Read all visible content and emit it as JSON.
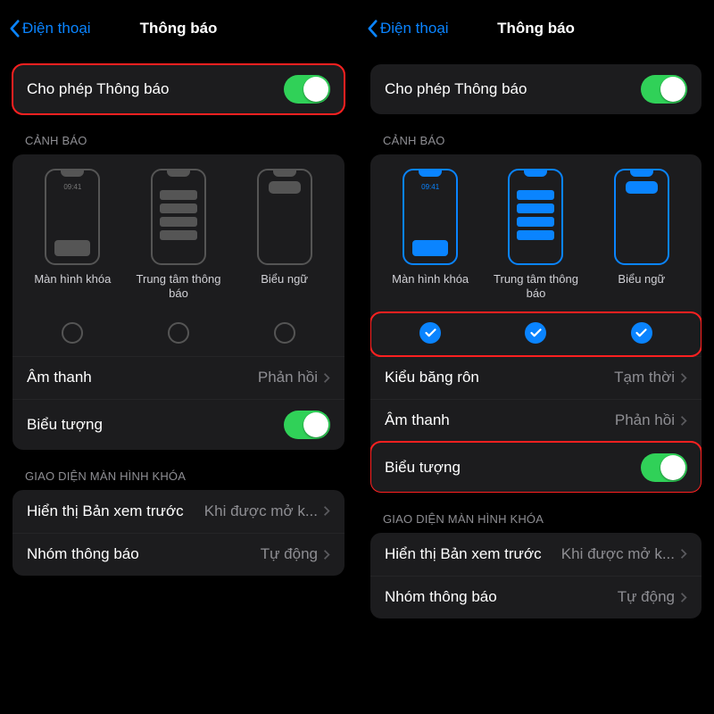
{
  "left": {
    "back_label": "Điện thoại",
    "title": "Thông báo",
    "allow": {
      "label": "Cho phép Thông báo",
      "on": true,
      "highlight": true
    },
    "alerts_header": "CẢNH BÁO",
    "alerts": [
      {
        "key": "lock",
        "label": "Màn hình khóa",
        "time": "09:41",
        "checked": false
      },
      {
        "key": "center",
        "label": "Trung tâm thông báo",
        "checked": false
      },
      {
        "key": "banner",
        "label": "Biểu ngữ",
        "checked": false
      }
    ],
    "check_highlight": false,
    "alerts_active": false,
    "banner_style_row": null,
    "sound": {
      "label": "Âm thanh",
      "value": "Phản hồi"
    },
    "badge": {
      "label": "Biểu tượng",
      "on": true,
      "highlight": false
    },
    "lockscreen_header": "GIAO DIỆN MÀN HÌNH KHÓA",
    "preview": {
      "label": "Hiển thị Bản xem trước",
      "value": "Khi được mở k..."
    },
    "grouping": {
      "label": "Nhóm thông báo",
      "value": "Tự động"
    }
  },
  "right": {
    "back_label": "Điện thoại",
    "title": "Thông báo",
    "allow": {
      "label": "Cho phép Thông báo",
      "on": true,
      "highlight": false
    },
    "alerts_header": "CẢNH BÁO",
    "alerts": [
      {
        "key": "lock",
        "label": "Màn hình khóa",
        "time": "09:41",
        "checked": true
      },
      {
        "key": "center",
        "label": "Trung tâm thông báo",
        "checked": true
      },
      {
        "key": "banner",
        "label": "Biểu ngữ",
        "checked": true
      }
    ],
    "check_highlight": true,
    "alerts_active": true,
    "banner_style_row": {
      "label": "Kiểu băng rôn",
      "value": "Tạm thời"
    },
    "sound": {
      "label": "Âm thanh",
      "value": "Phản hồi"
    },
    "badge": {
      "label": "Biểu tượng",
      "on": true,
      "highlight": true
    },
    "lockscreen_header": "GIAO DIỆN MÀN HÌNH KHÓA",
    "preview": {
      "label": "Hiển thị Bản xem trước",
      "value": "Khi được mở k..."
    },
    "grouping": {
      "label": "Nhóm thông báo",
      "value": "Tự động"
    }
  }
}
